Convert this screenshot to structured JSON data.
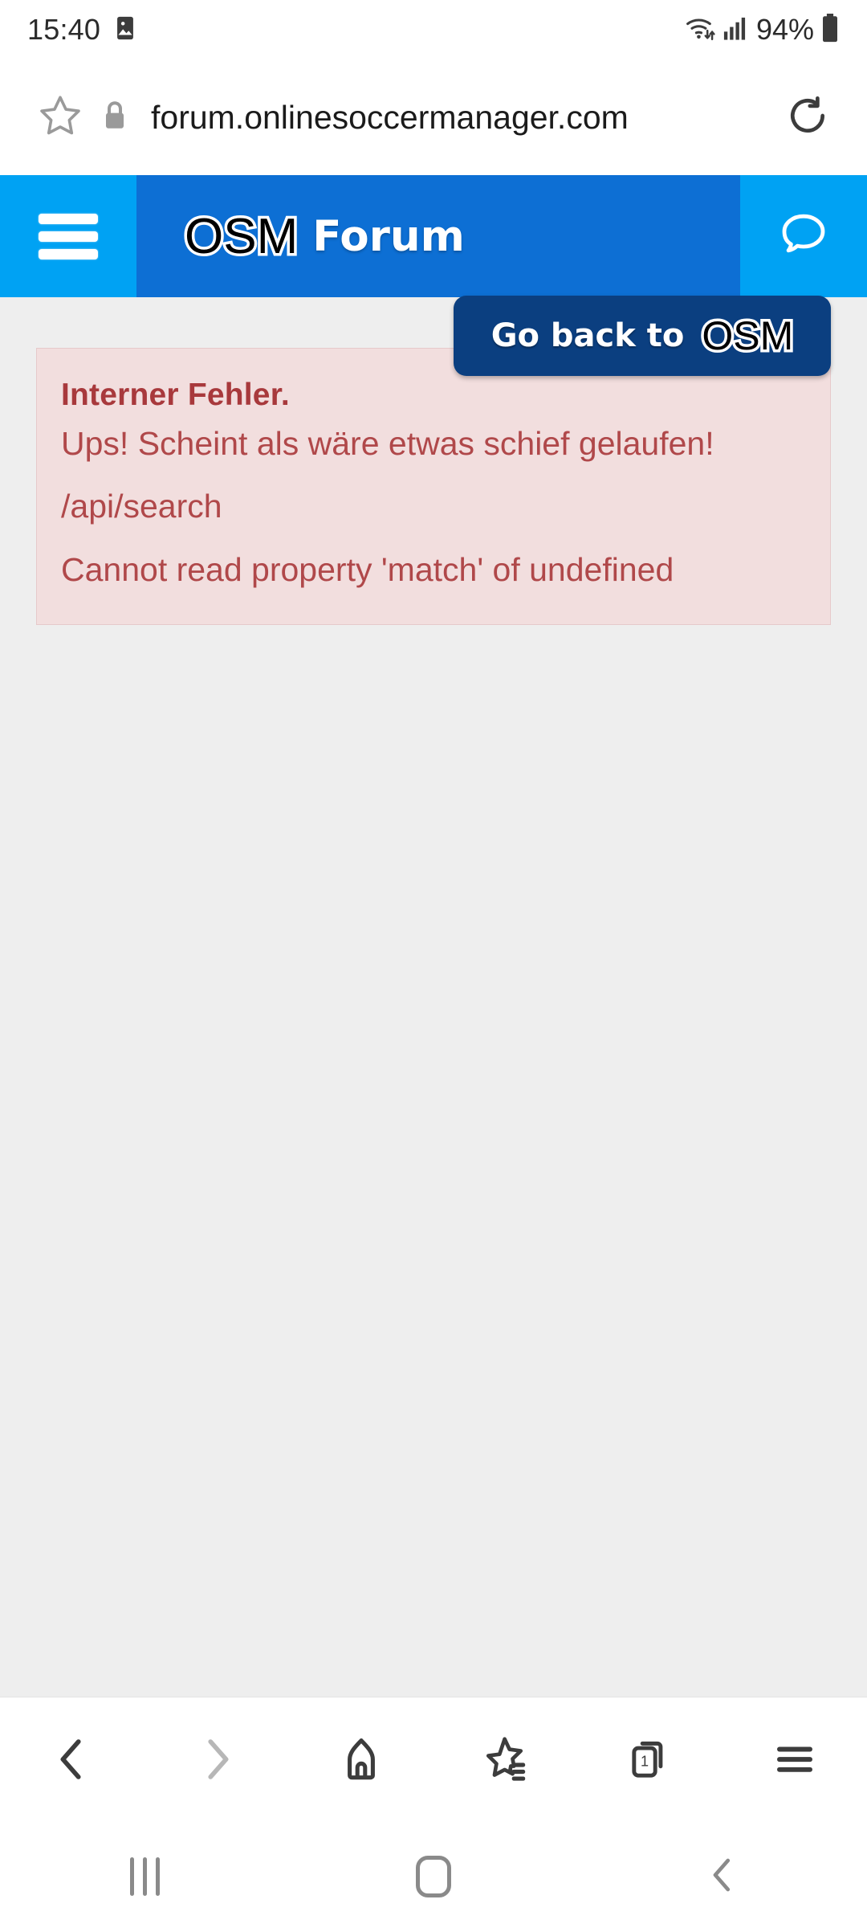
{
  "status_bar": {
    "time": "15:40",
    "battery_percent": "94%",
    "icons": [
      "screenshot-image-icon",
      "wifi-icon",
      "cellular-signal-icon",
      "battery-icon"
    ]
  },
  "url_bar": {
    "url": "forum.onlinesoccermanager.com",
    "bookmark_icon": "star-outline-icon",
    "security_icon": "lock-icon",
    "reload_icon": "reload-icon"
  },
  "site_header": {
    "menu_icon": "hamburger-menu-icon",
    "logo_text": "OSM",
    "title": "Forum",
    "chat_icon": "chat-bubble-icon",
    "colors": {
      "accent_light": "#00a2f3",
      "accent_dark": "#0d6fd4",
      "logo_orange": "#ff6a00"
    }
  },
  "go_back_button": {
    "label": "Go back to",
    "logo_text": "OSM",
    "background": "#0b3f80"
  },
  "error_alert": {
    "title": "Interner Fehler.",
    "message": "Ups! Scheint als wäre etwas schief gelaufen!",
    "endpoint": "/api/search",
    "detail": "Cannot read property 'match' of undefined",
    "background": "#f2dede",
    "text_color": "#b0484a"
  },
  "browser_toolbar": {
    "buttons": [
      {
        "name": "back",
        "icon": "chevron-left-icon",
        "enabled": true
      },
      {
        "name": "forward",
        "icon": "chevron-right-icon",
        "enabled": false
      },
      {
        "name": "home",
        "icon": "home-icon",
        "enabled": true
      },
      {
        "name": "bookmarks",
        "icon": "star-list-icon",
        "enabled": true
      },
      {
        "name": "tabs",
        "icon": "tabs-icon",
        "tab_count": "1",
        "enabled": true
      },
      {
        "name": "menu",
        "icon": "hamburger-menu-icon",
        "enabled": true
      }
    ]
  },
  "android_nav": {
    "recents_icon": "recents-icon",
    "home_icon": "home-square-icon",
    "back_icon": "chevron-left-icon"
  }
}
